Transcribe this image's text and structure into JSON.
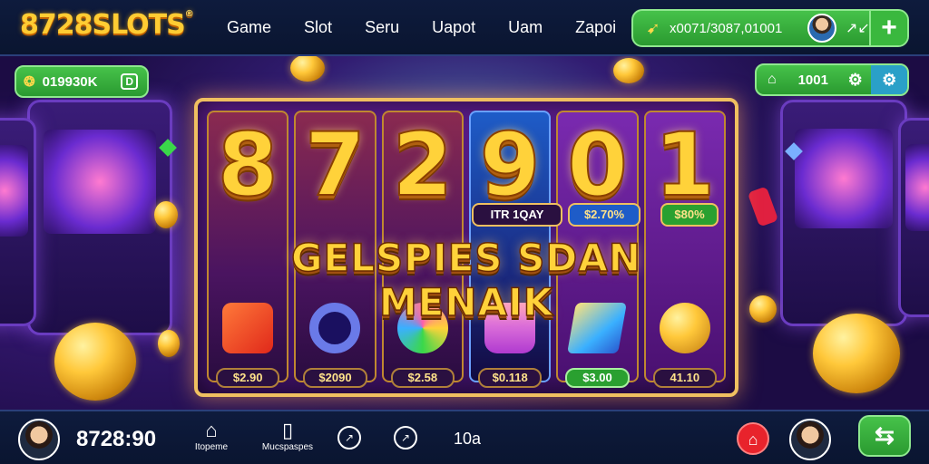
{
  "header": {
    "logo_text": "8728SLOTS",
    "logo_mark": "®",
    "nav": [
      "Game",
      "Slot",
      "Seru",
      "Uapot",
      "Uam",
      "Zapoi"
    ],
    "wallet": {
      "icon": "wallet-icon",
      "value": "x0071/3087,01001",
      "arrows": "↗↙"
    }
  },
  "side_left": {
    "icon": "coin-stack-icon",
    "value": "019930K",
    "end_icon": "d-icon"
  },
  "side_right": {
    "icon": "home-icon",
    "value": "1001",
    "gear_icon": "gear-icon",
    "settings_icon": "settings-icon"
  },
  "machine": {
    "digits": [
      "8",
      "7",
      "2",
      "9",
      "0",
      "1"
    ],
    "tags": [
      "ITR 1QAY",
      "$2.70%",
      "$80%"
    ],
    "banner": "GELSPIES SDAN MENAIK",
    "symbols": [
      "chip-stack",
      "poker-chip",
      "gem-ring",
      "crystal-cup",
      "gold-bar",
      "gold-coin"
    ],
    "prices": [
      "$2.90",
      "$2090",
      "$2.58",
      "$0.118",
      "$3.00",
      "41.10"
    ],
    "highlight_price_index": 4
  },
  "footer": {
    "balance": "8728:90",
    "items": [
      {
        "label": "Itopeme",
        "icon": "⌂"
      },
      {
        "label": "Mucspaspes",
        "icon": "▯"
      }
    ],
    "circles": [
      "↗",
      "↗"
    ],
    "text": "10a",
    "home_icon": "home-icon",
    "action_icon": "swap-icon"
  },
  "colors": {
    "brand_gold": "#ffd23a",
    "accent_green": "#3ab83e",
    "bar_navy": "#0e1b3d",
    "home_red": "#e8232c"
  }
}
